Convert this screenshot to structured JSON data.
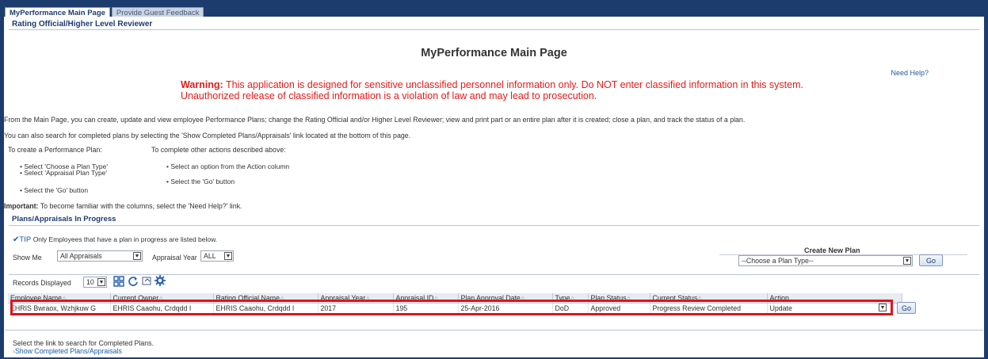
{
  "tabs": [
    {
      "label": "MyPerformance Main Page"
    },
    {
      "label": "Provide Guest Feedback"
    }
  ],
  "section_rating": "Rating Official/Higher Level Reviewer",
  "page_title": "MyPerformance Main Page",
  "need_help": "Need Help?",
  "warning": {
    "label": "Warning:",
    "text": " This application is designed for sensitive unclassified personnel information only. Do NOT enter classified information in this system. Unauthorized release of classified information is a violation of law and may lead to prosecution."
  },
  "intro1": "From the Main Page, you can create, update and view employee Performance Plans; change the Rating Official and/or Higher Level Reviewer; view and print part or an entire plan after it is created; close a plan, and track the status of a plan.",
  "intro2": "You can also search for completed plans by selecting the 'Show Completed Plans/Appraisals' link located at the bottom of this page.",
  "create_plan": {
    "heading": "To create a Performance Plan:",
    "bullets": [
      "Select 'Choose a Plan Type'",
      "Select 'Appraisal Plan Type'",
      "Select the 'Go' button"
    ]
  },
  "other_actions": {
    "heading": "To complete other actions described above:",
    "bullets": [
      "Select an option from the Action column",
      "Select the 'Go' button"
    ]
  },
  "important": {
    "label": "Important:",
    "text": " To become familiar with the columns, select the 'Need Help?' link."
  },
  "section_plans": "Plans/Appraisals In Progress",
  "tip": {
    "label": "TIP",
    "text": "Only Employees that have a plan in progress are listed below."
  },
  "filters": {
    "show_me_label": "Show Me",
    "show_me_value": "All Appraisals",
    "year_label": "Appraisal Year",
    "year_value": "ALL"
  },
  "create_new_plan": {
    "label": "Create New Plan",
    "select_value": "--Choose a Plan Type--",
    "go": "Go"
  },
  "records": {
    "label": "Records Displayed",
    "value": "10"
  },
  "table": {
    "columns": [
      "Employee Name",
      "Current Owner",
      "Rating Official Name",
      "Appraisal Year",
      "Appraisal ID",
      "Plan Approval Date",
      "Type",
      "Plan Status",
      "Current Status",
      "Action"
    ],
    "rows": [
      {
        "employee": "EHRIS Bwraox, Wzhjkuw G",
        "owner": "EHRIS Caaohu, Crdqdd I",
        "rating_official": "EHRIS Caaohu, Crdqdd I",
        "year": "2017",
        "id": "195",
        "approval_date": "25-Apr-2016",
        "type": "DoD",
        "plan_status": "Approved",
        "current_status": "Progress Review Completed",
        "action": "Update",
        "go": "Go"
      }
    ]
  },
  "footer": {
    "text": "Select the link to search for Completed Plans.",
    "link": "Show Completed Plans/Appraisals"
  },
  "colors": {
    "frame": "#1d3c6e",
    "warning": "#e41b1b",
    "highlight": "#e0131e",
    "link": "#1d5ba8"
  }
}
